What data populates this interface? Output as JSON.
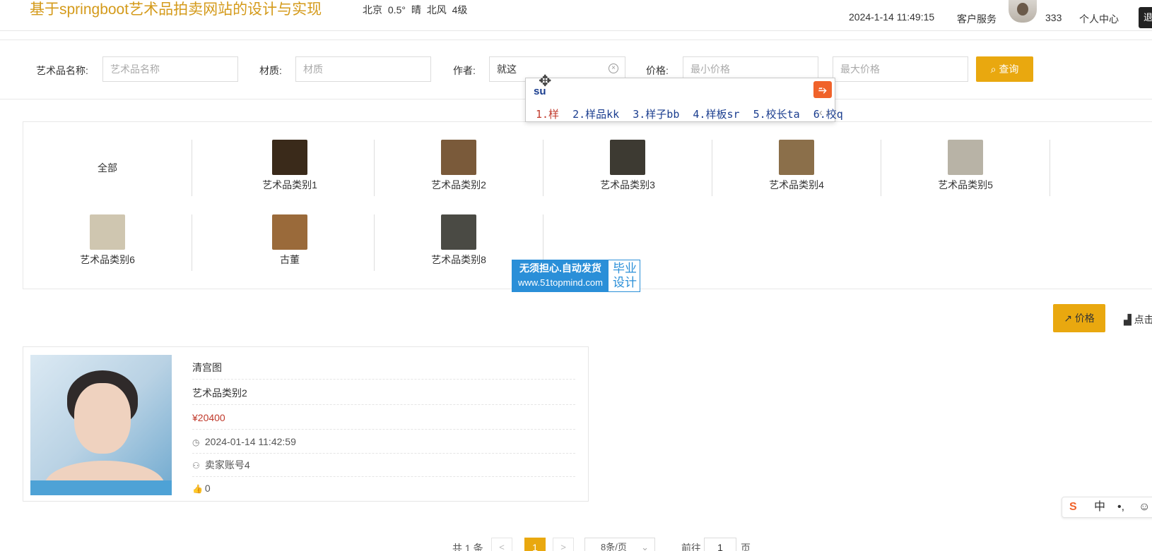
{
  "header": {
    "title": "基于springboot艺术品拍卖网站的设计与实现",
    "weather": "北京 0.5° 晴 北风 4级",
    "datetime": "2024-1-14 11:49:15",
    "service": "客户服务",
    "username": "333",
    "personal_center": "个人中心",
    "logout": "退"
  },
  "search": {
    "name_label": "艺术品名称:",
    "name_placeholder": "艺术品名称",
    "material_label": "材质:",
    "material_placeholder": "材质",
    "author_label": "作者:",
    "author_value": "就这",
    "price_label": "价格:",
    "min_placeholder": "最小价格",
    "max_placeholder": "最大价格",
    "query_button": "查询",
    "clear_icon": "clear-icon"
  },
  "ime_popup": {
    "input": "su",
    "candidates": [
      "1.样",
      "2.样品kk",
      "3.样子bb",
      "4.样板sr",
      "5.校长ta",
      "6.校q"
    ],
    "arrows": "‹ ›"
  },
  "categories": [
    {
      "label": "全部",
      "color": ""
    },
    {
      "label": "艺术品类别1",
      "color": "#3a2a1a"
    },
    {
      "label": "艺术品类别2",
      "color": "#7a5a3a"
    },
    {
      "label": "艺术品类别3",
      "color": "#3d3a32"
    },
    {
      "label": "艺术品类别4",
      "color": "#8b6f4a"
    },
    {
      "label": "艺术品类别5",
      "color": "#b8b3a6"
    },
    {
      "label": "艺术品类别6",
      "color": "#cfc6b0"
    },
    {
      "label": "古董",
      "color": "#9a6a3a"
    },
    {
      "label": "艺术品类别8",
      "color": "#4a4a44"
    }
  ],
  "watermark": {
    "line1": "无须担心.自动发货",
    "line2": "www.51topmind.com",
    "right": "毕业设计"
  },
  "sort": {
    "price": "价格",
    "click": "点击"
  },
  "item": {
    "title": "清宫图",
    "category": "艺术品类别2",
    "price": "¥20400",
    "time": "2024-01-14 11:42:59",
    "seller": "卖家账号4",
    "likes": "0"
  },
  "pagination": {
    "total": "共 1 条",
    "prev": "<",
    "current": "1",
    "next": ">",
    "page_size": "8条/页",
    "goto_label": "前往",
    "goto_value": "1",
    "page_suffix": "页"
  },
  "ime_toolbar": {
    "logo": "S",
    "lang": "中",
    "punct": "•,",
    "emoji": "☺"
  }
}
